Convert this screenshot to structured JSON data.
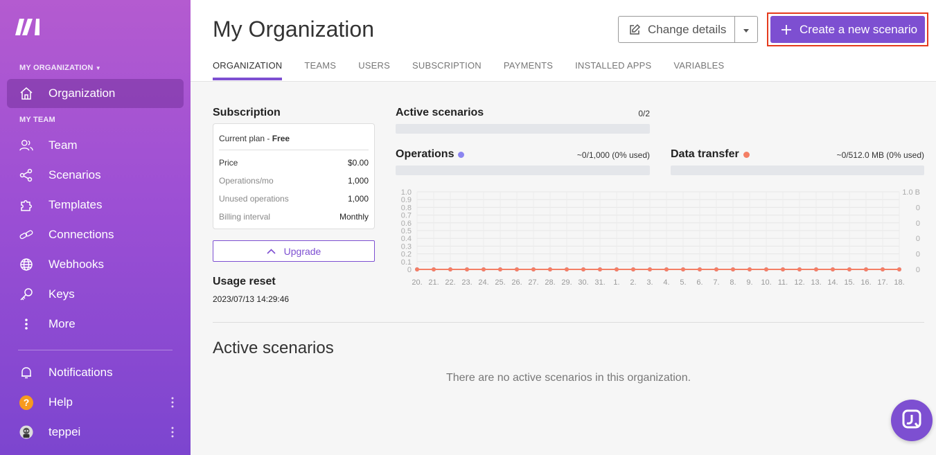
{
  "sidebar": {
    "org_section": "MY ORGANIZATION",
    "team_section": "MY TEAM",
    "items": [
      {
        "label": "Organization",
        "icon": "home-icon"
      },
      {
        "label": "Team",
        "icon": "users-icon"
      },
      {
        "label": "Scenarios",
        "icon": "share-icon"
      },
      {
        "label": "Templates",
        "icon": "puzzle-icon"
      },
      {
        "label": "Connections",
        "icon": "link-icon"
      },
      {
        "label": "Webhooks",
        "icon": "globe-icon"
      },
      {
        "label": "Keys",
        "icon": "key-icon"
      },
      {
        "label": "More",
        "icon": "more-vertical-icon"
      }
    ],
    "bottom": [
      {
        "label": "Notifications",
        "icon": "bell-icon"
      },
      {
        "label": "Help",
        "icon": "question-icon"
      },
      {
        "label": "teppei",
        "icon": "avatar"
      }
    ],
    "help_glyph": "?"
  },
  "header": {
    "title": "My Organization",
    "change_details": "Change details",
    "create_scenario": "Create a new scenario",
    "tabs": [
      "ORGANIZATION",
      "TEAMS",
      "USERS",
      "SUBSCRIPTION",
      "PAYMENTS",
      "INSTALLED APPS",
      "VARIABLES"
    ],
    "active_tab": "ORGANIZATION"
  },
  "subscription": {
    "title": "Subscription",
    "plan_prefix": "Current plan - ",
    "plan_name": "Free",
    "rows": [
      {
        "key": "Price",
        "value": "$0.00"
      },
      {
        "key": "Operations/mo",
        "value": "1,000"
      },
      {
        "key": "Unused operations",
        "value": "1,000"
      },
      {
        "key": "Billing interval",
        "value": "Monthly"
      }
    ],
    "upgrade": "Upgrade",
    "usage_reset_title": "Usage reset",
    "usage_reset_value": "2023/07/13 14:29:46"
  },
  "metrics": {
    "active_scenarios": {
      "label": "Active scenarios",
      "value": "0/2",
      "fill": 0
    },
    "operations": {
      "label": "Operations",
      "value": "~0/1,000 (0% used)",
      "fill": 0,
      "color": "#8b85f0"
    },
    "data_transfer": {
      "label": "Data transfer",
      "value": "~0/512.0 MB (0% used)",
      "fill": 0,
      "color": "#f47f65"
    }
  },
  "chart_data": {
    "type": "line",
    "x": [
      "20.",
      "21.",
      "22.",
      "23.",
      "24.",
      "25.",
      "26.",
      "27.",
      "28.",
      "29.",
      "30.",
      "31.",
      "1.",
      "2.",
      "3.",
      "4.",
      "5.",
      "6.",
      "7.",
      "8.",
      "9.",
      "10.",
      "11.",
      "12.",
      "13.",
      "14.",
      "15.",
      "16.",
      "17.",
      "18."
    ],
    "y_left_ticks": [
      "0",
      "0.1",
      "0.2",
      "0.3",
      "0.4",
      "0.5",
      "0.6",
      "0.7",
      "0.8",
      "0.9",
      "1.0"
    ],
    "y_right_ticks": [
      "0",
      "0",
      "0",
      "0",
      "0",
      "1.0 B"
    ],
    "ylim": [
      0,
      1
    ],
    "grid": true,
    "series": [
      {
        "values": [
          0,
          0,
          0,
          0,
          0,
          0,
          0,
          0,
          0,
          0,
          0,
          0,
          0,
          0,
          0,
          0,
          0,
          0,
          0,
          0,
          0,
          0,
          0,
          0,
          0,
          0,
          0,
          0,
          0,
          0
        ],
        "color": "#8b85f0"
      },
      {
        "values": [
          0,
          0,
          0,
          0,
          0,
          0,
          0,
          0,
          0,
          0,
          0,
          0,
          0,
          0,
          0,
          0,
          0,
          0,
          0,
          0,
          0,
          0,
          0,
          0,
          0,
          0,
          0,
          0,
          0,
          0
        ],
        "color": "#f47f65"
      }
    ]
  },
  "active_scenarios": {
    "title": "Active scenarios",
    "empty": "There are no active scenarios in this organization."
  }
}
